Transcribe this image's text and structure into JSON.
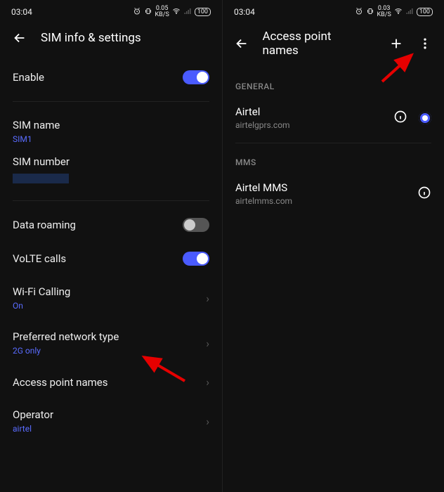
{
  "left": {
    "statusbar": {
      "time": "03:04",
      "speed": "0.05",
      "speed_unit": "KB/S",
      "battery": "100"
    },
    "title": "SIM info & settings",
    "rows": {
      "enable": {
        "label": "Enable",
        "state": "on"
      },
      "sim_name": {
        "label": "SIM name",
        "value": "SIM1"
      },
      "sim_number": {
        "label": "SIM number"
      },
      "data_roaming": {
        "label": "Data roaming",
        "state": "off"
      },
      "volte": {
        "label": "VoLTE calls",
        "state": "on"
      },
      "wifi_calling": {
        "label": "Wi-Fi Calling",
        "value": "On"
      },
      "pref_network": {
        "label": "Preferred network type",
        "value": "2G only"
      },
      "apn": {
        "label": "Access point names"
      },
      "operator": {
        "label": "Operator",
        "value": "airtel"
      }
    }
  },
  "right": {
    "statusbar": {
      "time": "03:04",
      "speed": "0.03",
      "speed_unit": "KB/S",
      "battery": "100"
    },
    "title": "Access point names",
    "sections": {
      "general": {
        "header": "GENERAL",
        "item": {
          "title": "Airtel",
          "sub": "airtelgprs.com",
          "selected": true
        }
      },
      "mms": {
        "header": "MMS",
        "item": {
          "title": "Airtel MMS",
          "sub": "airtelmms.com"
        }
      }
    }
  }
}
